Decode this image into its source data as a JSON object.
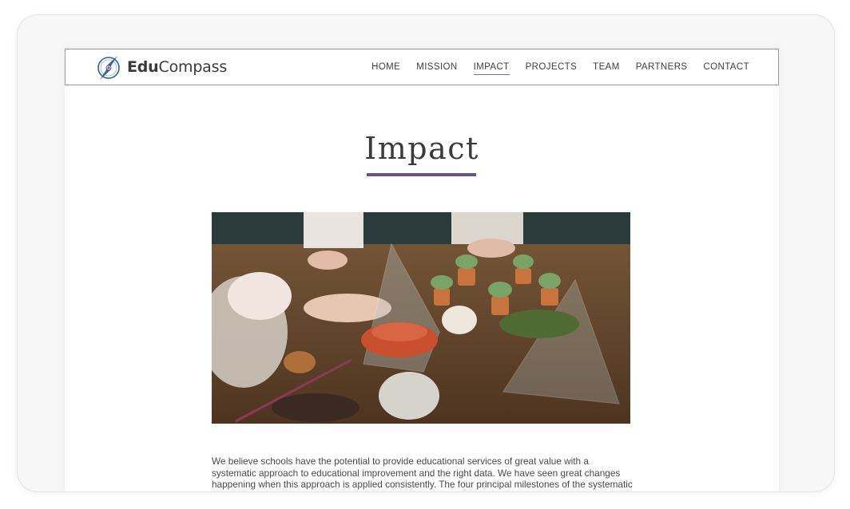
{
  "brand": {
    "bold": "Edu",
    "regular": "Compass"
  },
  "nav": {
    "items": [
      "HOME",
      "MISSION",
      "IMPACT",
      "PROJECTS",
      "TEAM",
      "PARTNERS",
      "CONTACT"
    ],
    "active": "IMPACT"
  },
  "page": {
    "title": "Impact",
    "intro": "We believe schools have the potential to provide educational services of great value with a systematic approach to educational improvement and the right data. We have seen great changes happening when this approach is applied consistently. The four principal milestones of the systematic approach are:"
  },
  "colors": {
    "accent": "#6b4f9a",
    "text": "#3a3a3a",
    "logo_blue": "#2f5fa8",
    "logo_red": "#d23a3a"
  }
}
